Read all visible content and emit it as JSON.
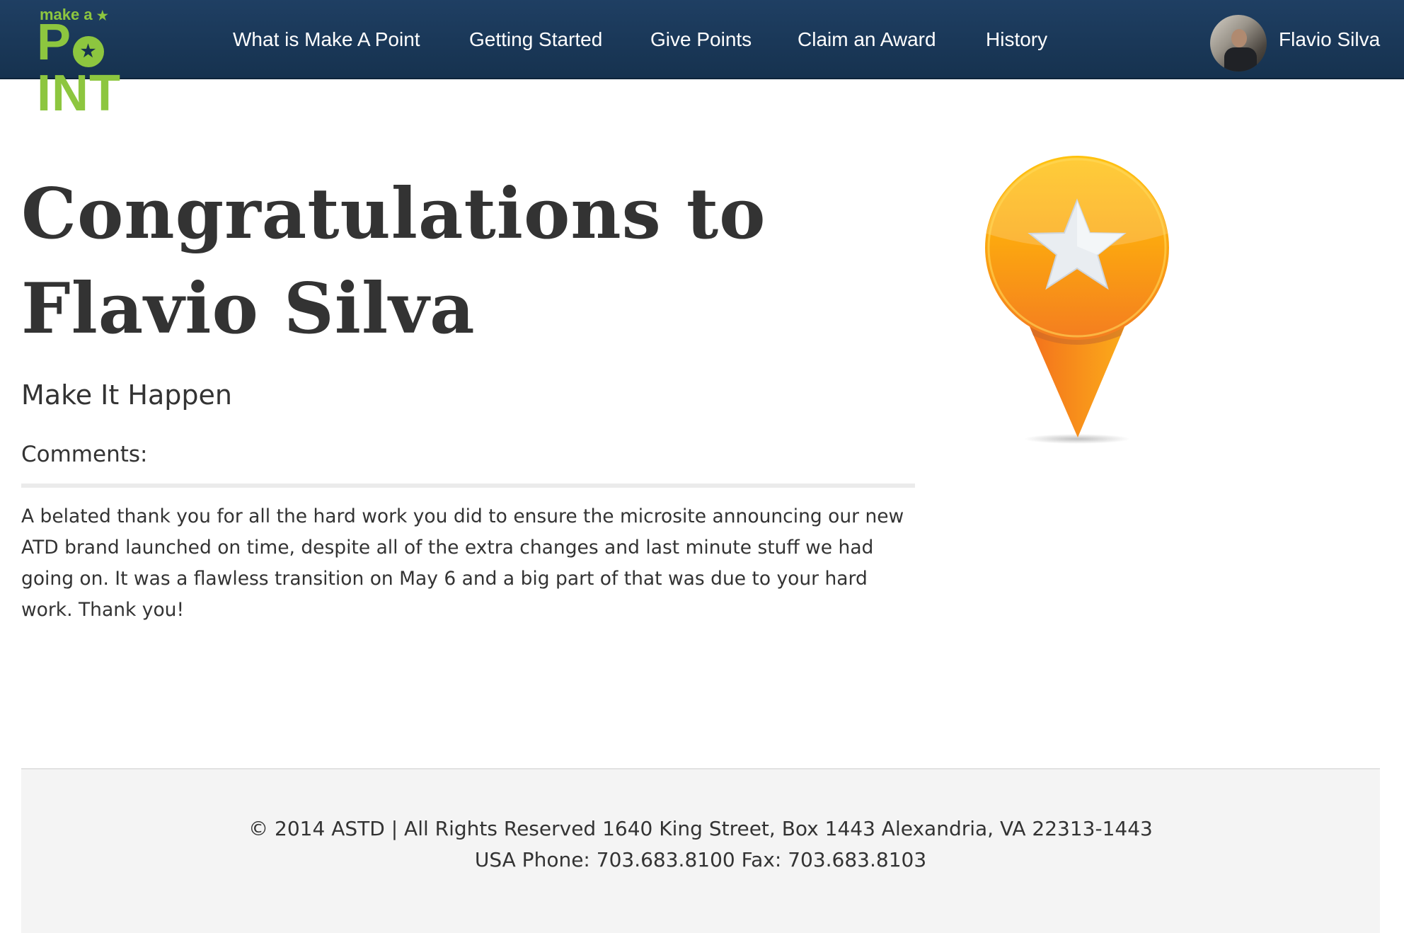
{
  "brand": {
    "logo_top": "make a",
    "logo_star": "★",
    "logo_letter_p": "P",
    "logo_letter_o_star": "★",
    "logo_rest": "INT"
  },
  "nav": {
    "items": [
      {
        "label": "What is Make A Point"
      },
      {
        "label": "Getting Started"
      },
      {
        "label": "Give Points"
      },
      {
        "label": "Claim an Award"
      },
      {
        "label": "History"
      }
    ],
    "user_name": "Flavio Silva"
  },
  "main": {
    "title": "Congratulations to Flavio Silva",
    "award_name": "Make It Happen",
    "comments_label": "Comments:",
    "comment_text": "A belated thank you for all the hard work you did to ensure the microsite announcing our new ATD brand launched on time, despite all of the extra changes and last minute stuff we had going on. It was a flawless transition on May 6 and a big part of that was due to your hard work. Thank you!"
  },
  "badge": {
    "icon": "star-pin-icon",
    "colors": {
      "top": "#ffc20e",
      "bottom": "#f47d20",
      "star": "#eceff3"
    }
  },
  "footer": {
    "line1": "© 2014 ASTD | All Rights Reserved 1640 King Street, Box 1443 Alexandria, VA 22313-1443",
    "line2": "USA Phone: 703.683.8100 Fax: 703.683.8103"
  },
  "colors": {
    "navbar": "#1b3a5c",
    "brand_green": "#8dc63f",
    "text": "#333333",
    "footer_bg": "#f4f4f4"
  }
}
